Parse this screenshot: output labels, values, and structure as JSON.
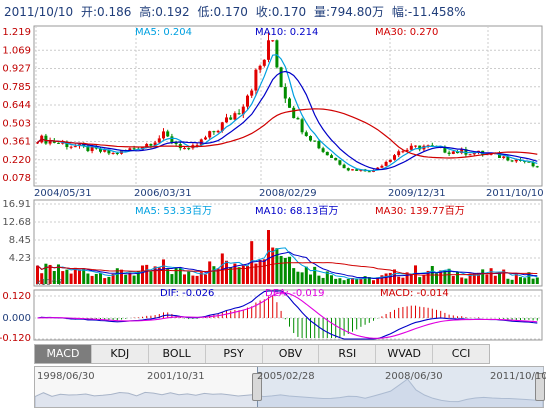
{
  "info": {
    "date": "2011/10/10",
    "open": "开:0.186",
    "high": "高:0.192",
    "low": "低:0.170",
    "close": "收:0.170",
    "volume": "量:794.80万",
    "change": "幅:-11.458%"
  },
  "price_panel": {
    "ma5": "MA5: 0.204",
    "ma10": "MA10: 0.214",
    "ma30": "MA30: 0.270",
    "y_ticks": [
      "1.219",
      "1.069",
      "0.927",
      "0.785",
      "0.644",
      "0.503",
      "0.361",
      "0.220",
      "0.078"
    ],
    "x_ticks": [
      "2004/05/31",
      "2006/03/31",
      "2008/02/29",
      "2009/12/31",
      "2011/10/10"
    ]
  },
  "volume_panel": {
    "ma5": "MA5: 53.33百万",
    "ma10": "MA10: 68.13百万",
    "ma30": "MA30: 139.77百万",
    "y_ticks": [
      "16.91",
      "12.68",
      "8.45",
      "4.23"
    ],
    "unit": "x10^7"
  },
  "macd_panel": {
    "dif": "DIF: -0.026",
    "dea": "DEA: -0.019",
    "macd": "MACD: -0.014",
    "y_ticks": [
      "0.120",
      "0.000",
      "-0.120"
    ]
  },
  "tabs": [
    "MACD",
    "KDJ",
    "BOLL",
    "PSY",
    "OBV",
    "RSI",
    "WVAD",
    "CCI"
  ],
  "active_tab": "MACD",
  "navigator": {
    "dates": [
      "1998/06/30",
      "2001/10/31",
      "2005/02/28",
      "2008/06/30",
      "2011/10/10"
    ]
  },
  "colors": {
    "up": "#e00000",
    "down": "#008c00",
    "ma5": "#00a0e0",
    "ma10": "#0000c8",
    "ma30": "#d00000",
    "dif": "#0000c8",
    "dea": "#e000e0",
    "grid": "#cccccc"
  }
}
